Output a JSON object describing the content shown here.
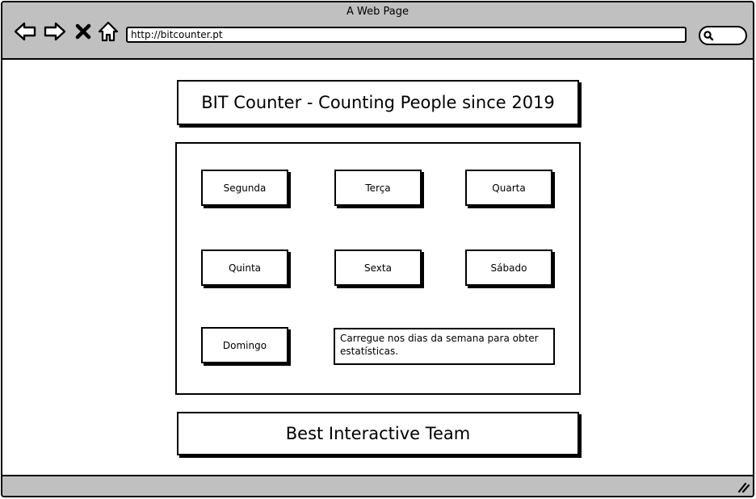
{
  "window": {
    "title": "A Web Page"
  },
  "browser": {
    "url": "http://bitcounter.pt",
    "icons": [
      "back-arrow-icon",
      "forward-arrow-icon",
      "close-icon",
      "home-icon",
      "search-icon",
      "resize-grip-icon"
    ]
  },
  "header": {
    "title": "BIT Counter - Counting People since 2019"
  },
  "days": {
    "monday": "Segunda",
    "tuesday": "Terça",
    "wednesday": "Quarta",
    "thursday": "Quinta",
    "friday": "Sexta",
    "saturday": "Sábado",
    "sunday": "Domingo"
  },
  "info": {
    "text": "Carregue nos dias da semana para obter estatísticas."
  },
  "footer": {
    "text": "Best Interactive Team"
  },
  "colors": {
    "chrome": "#c0c0c0",
    "stroke": "#000000",
    "background": "#ffffff"
  }
}
